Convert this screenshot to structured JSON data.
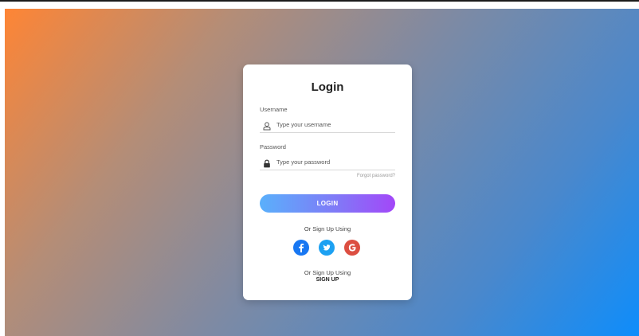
{
  "login": {
    "title": "Login",
    "username": {
      "label": "Username",
      "placeholder": "Type your username",
      "icon": "user-icon"
    },
    "password": {
      "label": "Password",
      "placeholder": "Type your password",
      "icon": "lock-icon"
    },
    "forgot_password": "Forgot password?",
    "login_button": "LOGIN",
    "social_prompt": "Or Sign Up Using",
    "social": [
      {
        "name": "facebook",
        "icon": "facebook-icon",
        "color": "#1877f2"
      },
      {
        "name": "twitter",
        "icon": "twitter-icon",
        "color": "#1da1f2"
      },
      {
        "name": "google",
        "icon": "google-icon",
        "color": "#dc4e41"
      }
    ],
    "signup_prompt": "Or Sign Up Using",
    "signup_link": "SIGN UP"
  },
  "colors": {
    "background_start": "#fe8535",
    "background_end": "#0e8dfb",
    "button_start": "#5ab0fb",
    "button_end": "#a347f8"
  }
}
